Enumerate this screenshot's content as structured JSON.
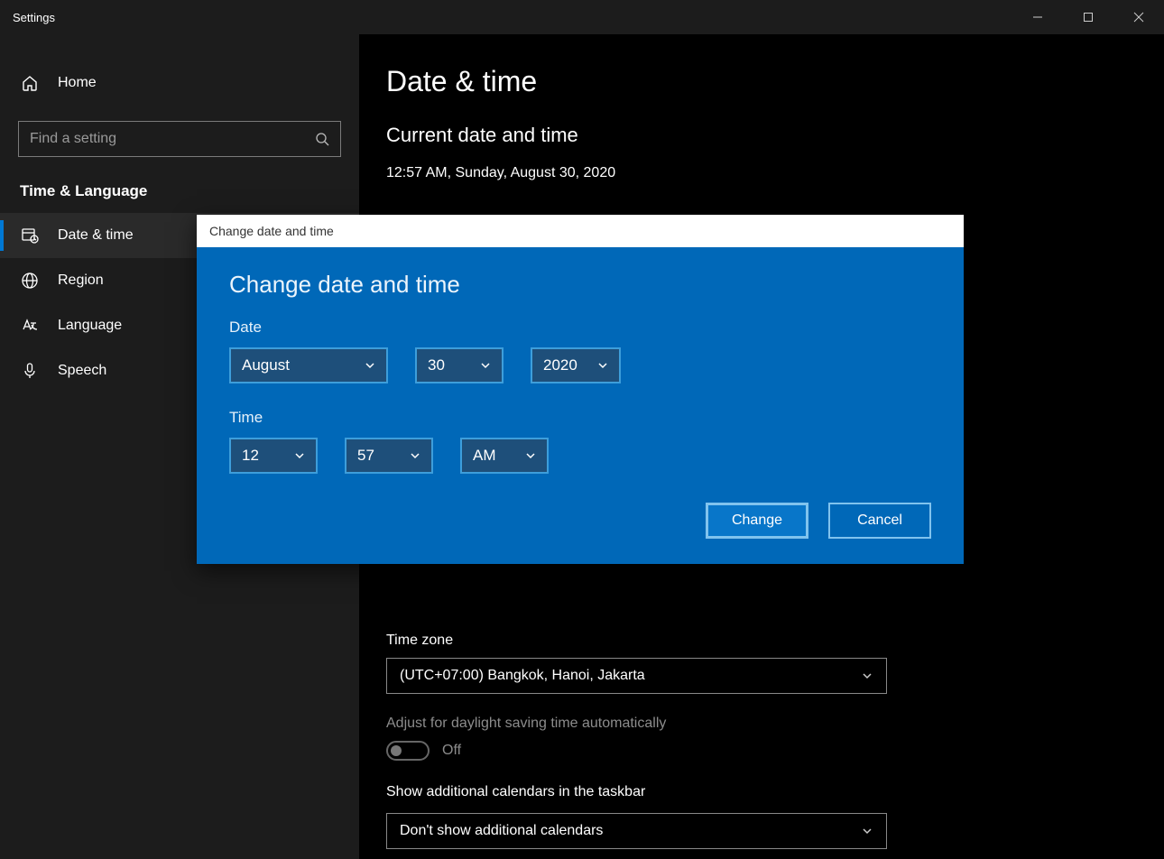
{
  "window": {
    "title": "Settings"
  },
  "sidebar": {
    "home": "Home",
    "search_placeholder": "Find a setting",
    "section": "Time & Language",
    "items": [
      {
        "label": "Date & time"
      },
      {
        "label": "Region"
      },
      {
        "label": "Language"
      },
      {
        "label": "Speech"
      }
    ]
  },
  "main": {
    "title": "Date & time",
    "current_heading": "Current date and time",
    "current_value": "12:57 AM, Sunday, August 30, 2020",
    "timezone_label": "Time zone",
    "timezone_value": "(UTC+07:00) Bangkok, Hanoi, Jakarta",
    "dst_label": "Adjust for daylight saving time automatically",
    "dst_state": "Off",
    "additional_label": "Show additional calendars in the taskbar",
    "additional_value": "Don't show additional calendars"
  },
  "dialog": {
    "titlebar": "Change date and time",
    "heading": "Change date and time",
    "date_label": "Date",
    "time_label": "Time",
    "month": "August",
    "day": "30",
    "year": "2020",
    "hour": "12",
    "minute": "57",
    "ampm": "AM",
    "change_btn": "Change",
    "cancel_btn": "Cancel"
  }
}
